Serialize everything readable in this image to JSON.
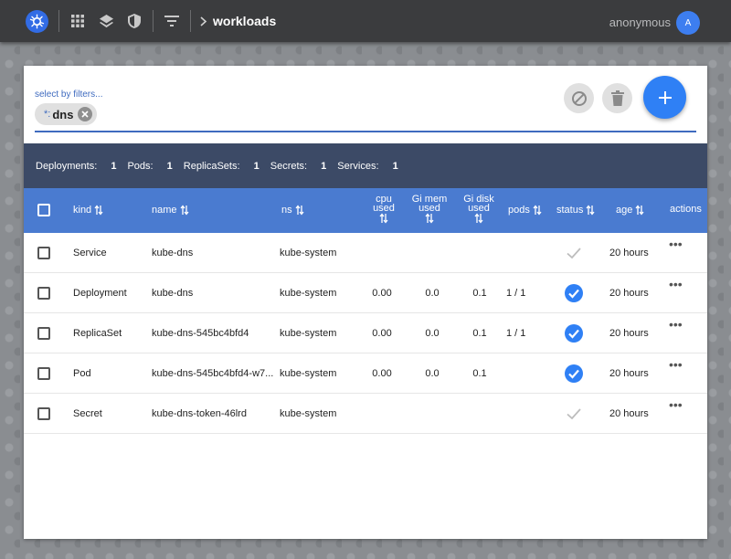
{
  "topbar": {
    "breadcrumb": "workloads",
    "user_name": "anonymous",
    "avatar_letter": "A",
    "icons": [
      "kubernetes-logo",
      "apps-grid-icon",
      "layers-icon",
      "shield-icon",
      "filter-icon",
      "chevron-right-icon"
    ]
  },
  "filter": {
    "label": "select by filters...",
    "chip_prefix": "*:",
    "chip_value": "dns"
  },
  "summary": [
    {
      "label": "Deployments:",
      "count": "1"
    },
    {
      "label": "Pods:",
      "count": "1"
    },
    {
      "label": "ReplicaSets:",
      "count": "1"
    },
    {
      "label": "Secrets:",
      "count": "1"
    },
    {
      "label": "Services:",
      "count": "1"
    }
  ],
  "columns": {
    "kind": "kind",
    "name": "name",
    "ns": "ns",
    "cpu_line1": "cpu",
    "cpu_line2": "used",
    "mem_line1": "Gi mem",
    "mem_line2": "used",
    "disk_line1": "Gi disk",
    "disk_line2": "used",
    "pods": "pods",
    "status": "status",
    "age": "age",
    "actions": "actions"
  },
  "rows": [
    {
      "kind": "Service",
      "name": "kube-dns",
      "ns": "kube-system",
      "cpu": "",
      "mem": "",
      "disk": "",
      "pods": "",
      "status": "ok-plain",
      "age": "20 hours",
      "actions": "•••"
    },
    {
      "kind": "Deployment",
      "name": "kube-dns",
      "ns": "kube-system",
      "cpu": "0.00",
      "mem": "0.0",
      "disk": "0.1",
      "pods": "1 / 1",
      "status": "ok-filled",
      "age": "20 hours",
      "actions": "•••"
    },
    {
      "kind": "ReplicaSet",
      "name": "kube-dns-545bc4bfd4",
      "ns": "kube-system",
      "cpu": "0.00",
      "mem": "0.0",
      "disk": "0.1",
      "pods": "1 / 1",
      "status": "ok-filled",
      "age": "20 hours",
      "actions": "•••"
    },
    {
      "kind": "Pod",
      "name": "kube-dns-545bc4bfd4-w7...",
      "ns": "kube-system",
      "cpu": "0.00",
      "mem": "0.0",
      "disk": "0.1",
      "pods": "",
      "status": "ok-filled",
      "age": "20 hours",
      "actions": "•••"
    },
    {
      "kind": "Secret",
      "name": "kube-dns-token-46lrd",
      "ns": "kube-system",
      "cpu": "",
      "mem": "",
      "disk": "",
      "pods": "",
      "status": "ok-plain",
      "age": "20 hours",
      "actions": "•••"
    }
  ],
  "colors": {
    "accent": "#2f80f5",
    "header_bg": "#4a7bd0",
    "summary_bg": "#3c4a66",
    "topbar_bg": "#3b3c3e"
  }
}
